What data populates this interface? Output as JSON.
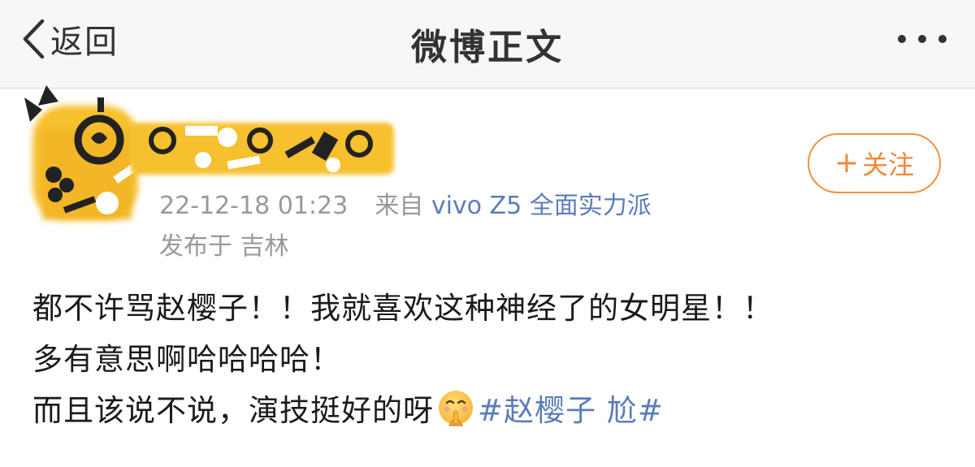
{
  "navbar": {
    "back_label": "返回",
    "title": "微博正文",
    "back_icon": "chevron-left-icon",
    "more_icon": "more-dots-icon"
  },
  "author": {
    "timestamp": "22-12-18 01:23",
    "source_prefix": "来自",
    "source_device": "vivo Z5 全面实力派",
    "location": "发布于 吉林",
    "follow_plus": "+",
    "follow_label": "关注"
  },
  "post": {
    "line1": "都不许骂赵樱子！！我就喜欢这种神经了的女明星！！",
    "line2": "多有意思啊哈哈哈哈！",
    "line3_text": "而且该说不说，演技挺好的呀",
    "emoji": "shushing-face-emoji",
    "hashtag": "#赵樱子 尬#"
  },
  "colors": {
    "accent_orange": "#f0923f",
    "link_blue": "#5b7db8",
    "meta_gray": "#999999",
    "avatar_yellow": "#f6c02e"
  }
}
